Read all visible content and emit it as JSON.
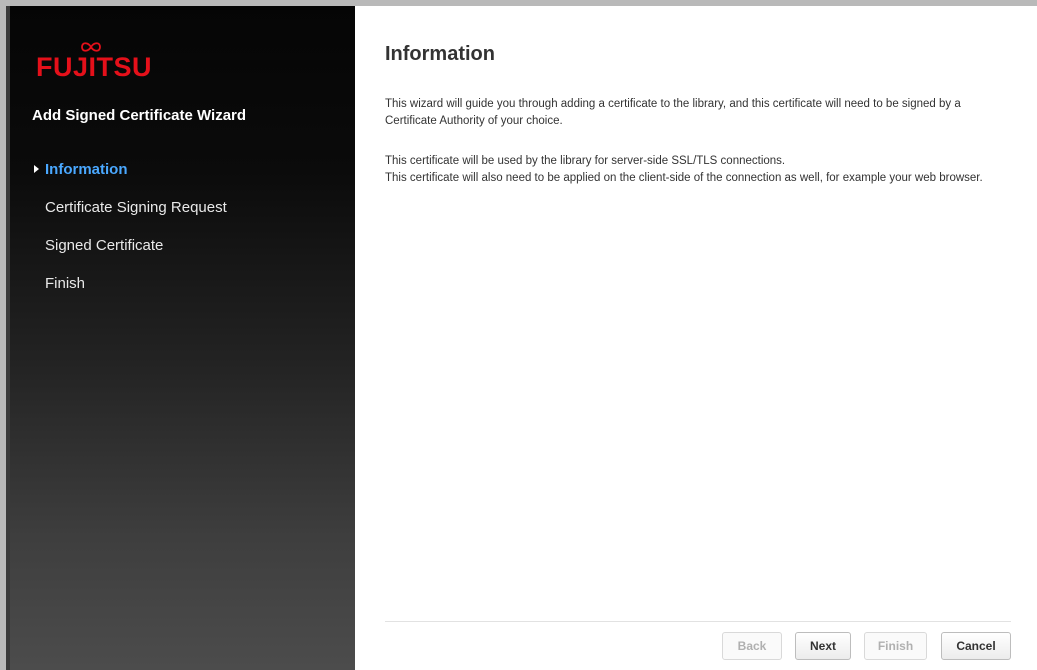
{
  "brand": {
    "logo_text": "FUJITSU",
    "logo_color": "#e5101a"
  },
  "sidebar": {
    "wizard_title": "Add Signed Certificate Wizard",
    "steps": [
      {
        "label": "Information",
        "active": true
      },
      {
        "label": "Certificate Signing Request",
        "active": false
      },
      {
        "label": "Signed Certificate",
        "active": false
      },
      {
        "label": "Finish",
        "active": false
      }
    ],
    "active_color": "#4aa8ff"
  },
  "main": {
    "title": "Information",
    "paragraph1": "This wizard will guide you through adding a certificate to the library, and this certificate will need to be signed by a Certificate Authority of your choice.",
    "paragraph2_line1": "This certificate will be used by the library for server-side SSL/TLS connections.",
    "paragraph2_line2": "This certificate will also need to be applied on the client-side of the connection as well, for example your web browser."
  },
  "buttons": {
    "back": {
      "label": "Back",
      "enabled": false
    },
    "next": {
      "label": "Next",
      "enabled": true
    },
    "finish": {
      "label": "Finish",
      "enabled": false
    },
    "cancel": {
      "label": "Cancel",
      "enabled": true
    }
  }
}
